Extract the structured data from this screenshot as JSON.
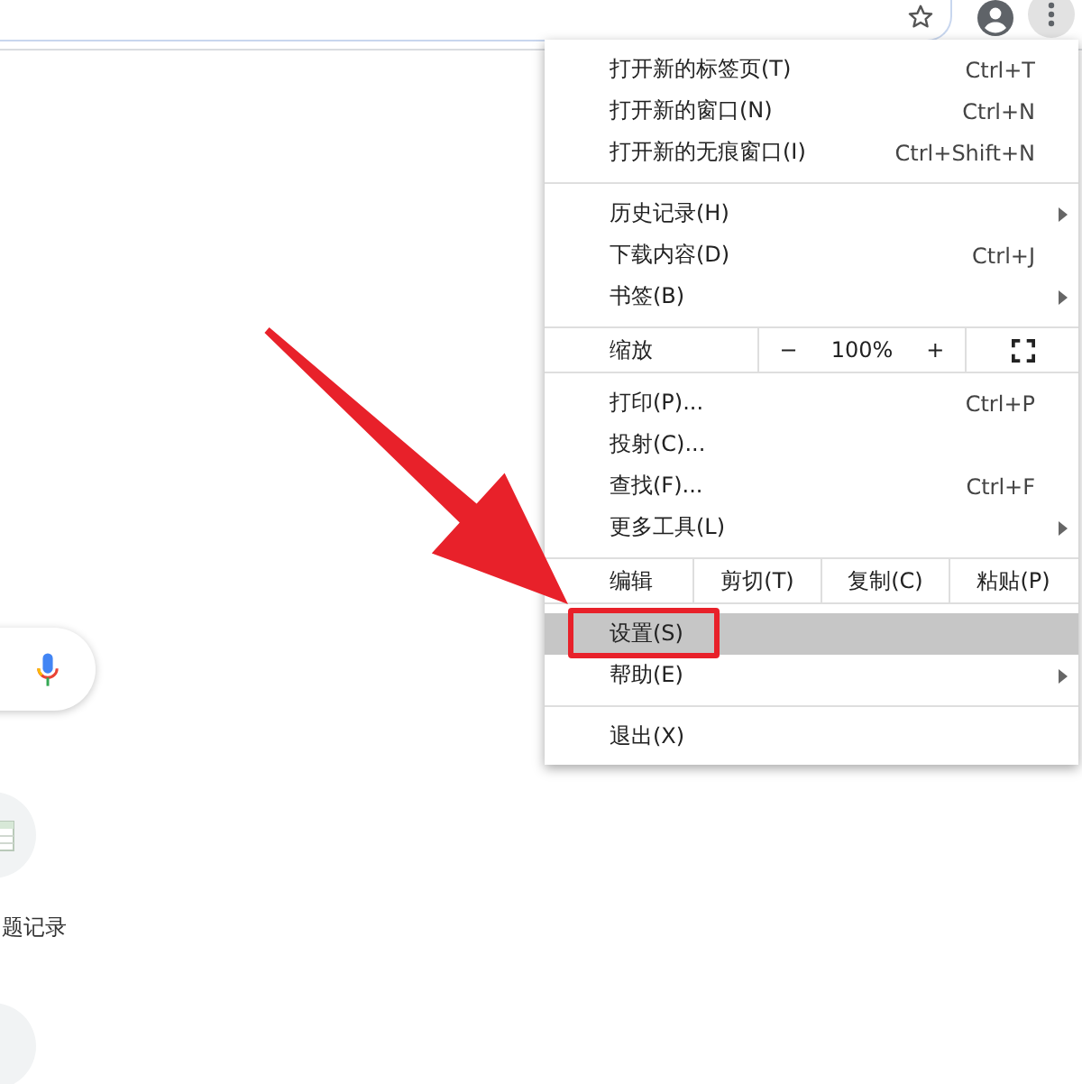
{
  "toolbar": {
    "menu_open": true
  },
  "menu": [
    {
      "kind": "item",
      "label": "打开新的标签页(T)",
      "shortcut": "Ctrl+T",
      "submenu": false,
      "selected": false
    },
    {
      "kind": "item",
      "label": "打开新的窗口(N)",
      "shortcut": "Ctrl+N",
      "submenu": false,
      "selected": false
    },
    {
      "kind": "item",
      "label": "打开新的无痕窗口(I)",
      "shortcut": "Ctrl+Shift+N",
      "submenu": false,
      "selected": false
    },
    {
      "kind": "separator"
    },
    {
      "kind": "item",
      "label": "历史记录(H)",
      "submenu": true,
      "selected": false
    },
    {
      "kind": "item",
      "label": "下载内容(D)",
      "shortcut": "Ctrl+J",
      "submenu": false,
      "selected": false
    },
    {
      "kind": "item",
      "label": "书签(B)",
      "submenu": true,
      "selected": false
    },
    {
      "kind": "separator"
    },
    {
      "kind": "zoom",
      "label": "缩放",
      "minus": "−",
      "value": "100%",
      "plus": "+"
    },
    {
      "kind": "separator"
    },
    {
      "kind": "item",
      "label": "打印(P)...",
      "shortcut": "Ctrl+P",
      "submenu": false,
      "selected": false
    },
    {
      "kind": "item",
      "label": "投射(C)...",
      "submenu": false,
      "selected": false
    },
    {
      "kind": "item",
      "label": "查找(F)...",
      "shortcut": "Ctrl+F",
      "submenu": false,
      "selected": false
    },
    {
      "kind": "item",
      "label": "更多工具(L)",
      "submenu": true,
      "selected": false
    },
    {
      "kind": "separator"
    },
    {
      "kind": "edit",
      "label": "编辑",
      "actions": [
        "剪切(T)",
        "复制(C)",
        "粘贴(P)"
      ]
    },
    {
      "kind": "separator"
    },
    {
      "kind": "item",
      "label": "设置(S)",
      "submenu": false,
      "selected": true,
      "highlighted": true
    },
    {
      "kind": "item",
      "label": "帮助(E)",
      "submenu": true,
      "selected": false
    },
    {
      "kind": "separator"
    },
    {
      "kind": "item",
      "label": "退出(X)",
      "submenu": false,
      "selected": false
    }
  ],
  "page": {
    "shortcut_label": "题记录"
  }
}
